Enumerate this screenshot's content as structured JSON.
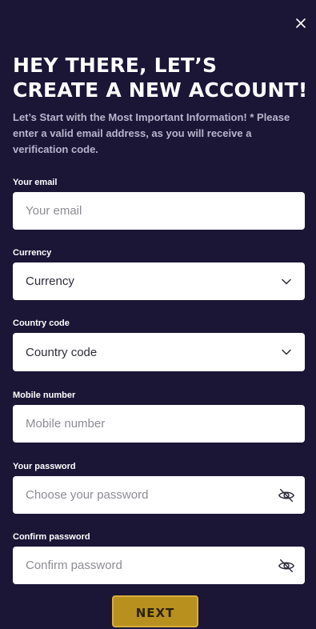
{
  "header": {
    "title": "HEY THERE, LET’S CREATE A NEW ACCOUNT!",
    "subtitle": "Let’s Start with the Most Important Information! * Please enter a valid email address, as you will receive a verification code."
  },
  "form": {
    "email": {
      "label": "Your email",
      "placeholder": "Your email"
    },
    "currency": {
      "label": "Currency",
      "value": "Currency"
    },
    "country_code": {
      "label": "Country code",
      "value": "Country code"
    },
    "mobile": {
      "label": "Mobile number",
      "placeholder": "Mobile number"
    },
    "password": {
      "label": "Your password",
      "placeholder": "Choose your password"
    },
    "confirm_password": {
      "label": "Confirm password",
      "placeholder": "Confirm password"
    }
  },
  "actions": {
    "next_label": "NEXT"
  },
  "icons": {
    "close": "close-icon",
    "chevron": "chevron-down-icon",
    "eye": "eye-off-icon"
  },
  "colors": {
    "background": "#1b1536",
    "field": "#ffffff",
    "button": "#b8901e"
  }
}
